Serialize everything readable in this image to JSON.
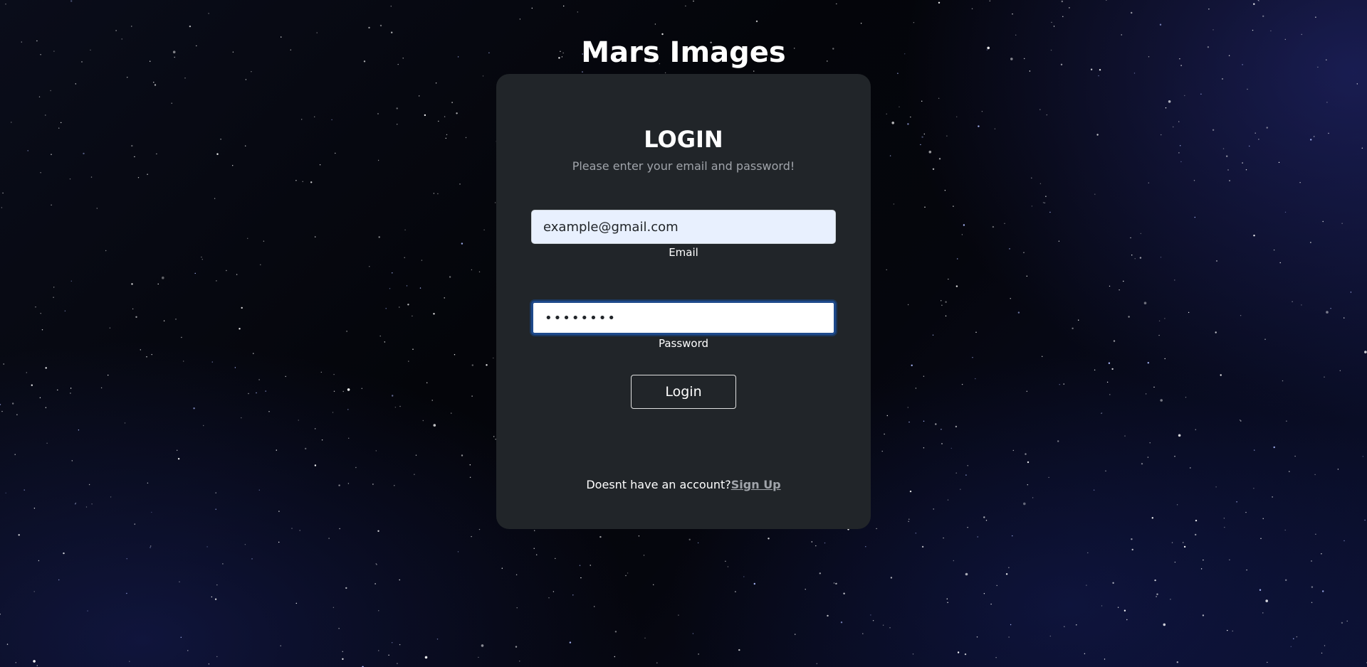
{
  "app": {
    "title": "Mars Images"
  },
  "login_form": {
    "heading": "LOGIN",
    "subtitle": "Please enter your email and password!",
    "email": {
      "value": "example@gmail.com",
      "label": "Email"
    },
    "password": {
      "value": "••••••••",
      "label": "Password"
    },
    "submit_label": "Login",
    "signup_prompt": "Doesnt have an account?",
    "signup_link": "Sign Up"
  },
  "colors": {
    "card_background": "#212529",
    "email_field_background": "#e8f0fe",
    "focus_border": "#1e4a8c",
    "muted_text": "#a0a4aa"
  }
}
